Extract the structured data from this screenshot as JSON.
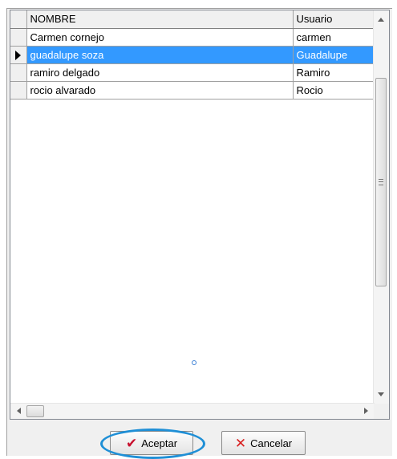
{
  "grid": {
    "columns": {
      "name": "NOMBRE",
      "user": "Usuario"
    },
    "rows": [
      {
        "name": "Carmen cornejo",
        "user": "carmen",
        "selected": false
      },
      {
        "name": "guadalupe soza",
        "user": "Guadalupe",
        "selected": true
      },
      {
        "name": "ramiro delgado",
        "user": "Ramiro",
        "selected": false
      },
      {
        "name": "rocio alvarado",
        "user": "Rocio",
        "selected": false
      }
    ],
    "selected_color": "#3399ff"
  },
  "buttons": {
    "accept_label": "Aceptar",
    "cancel_label": "Cancelar",
    "accept_icon": "check-icon",
    "cancel_icon": "x-icon"
  },
  "highlight_color": "#1f8fd6"
}
